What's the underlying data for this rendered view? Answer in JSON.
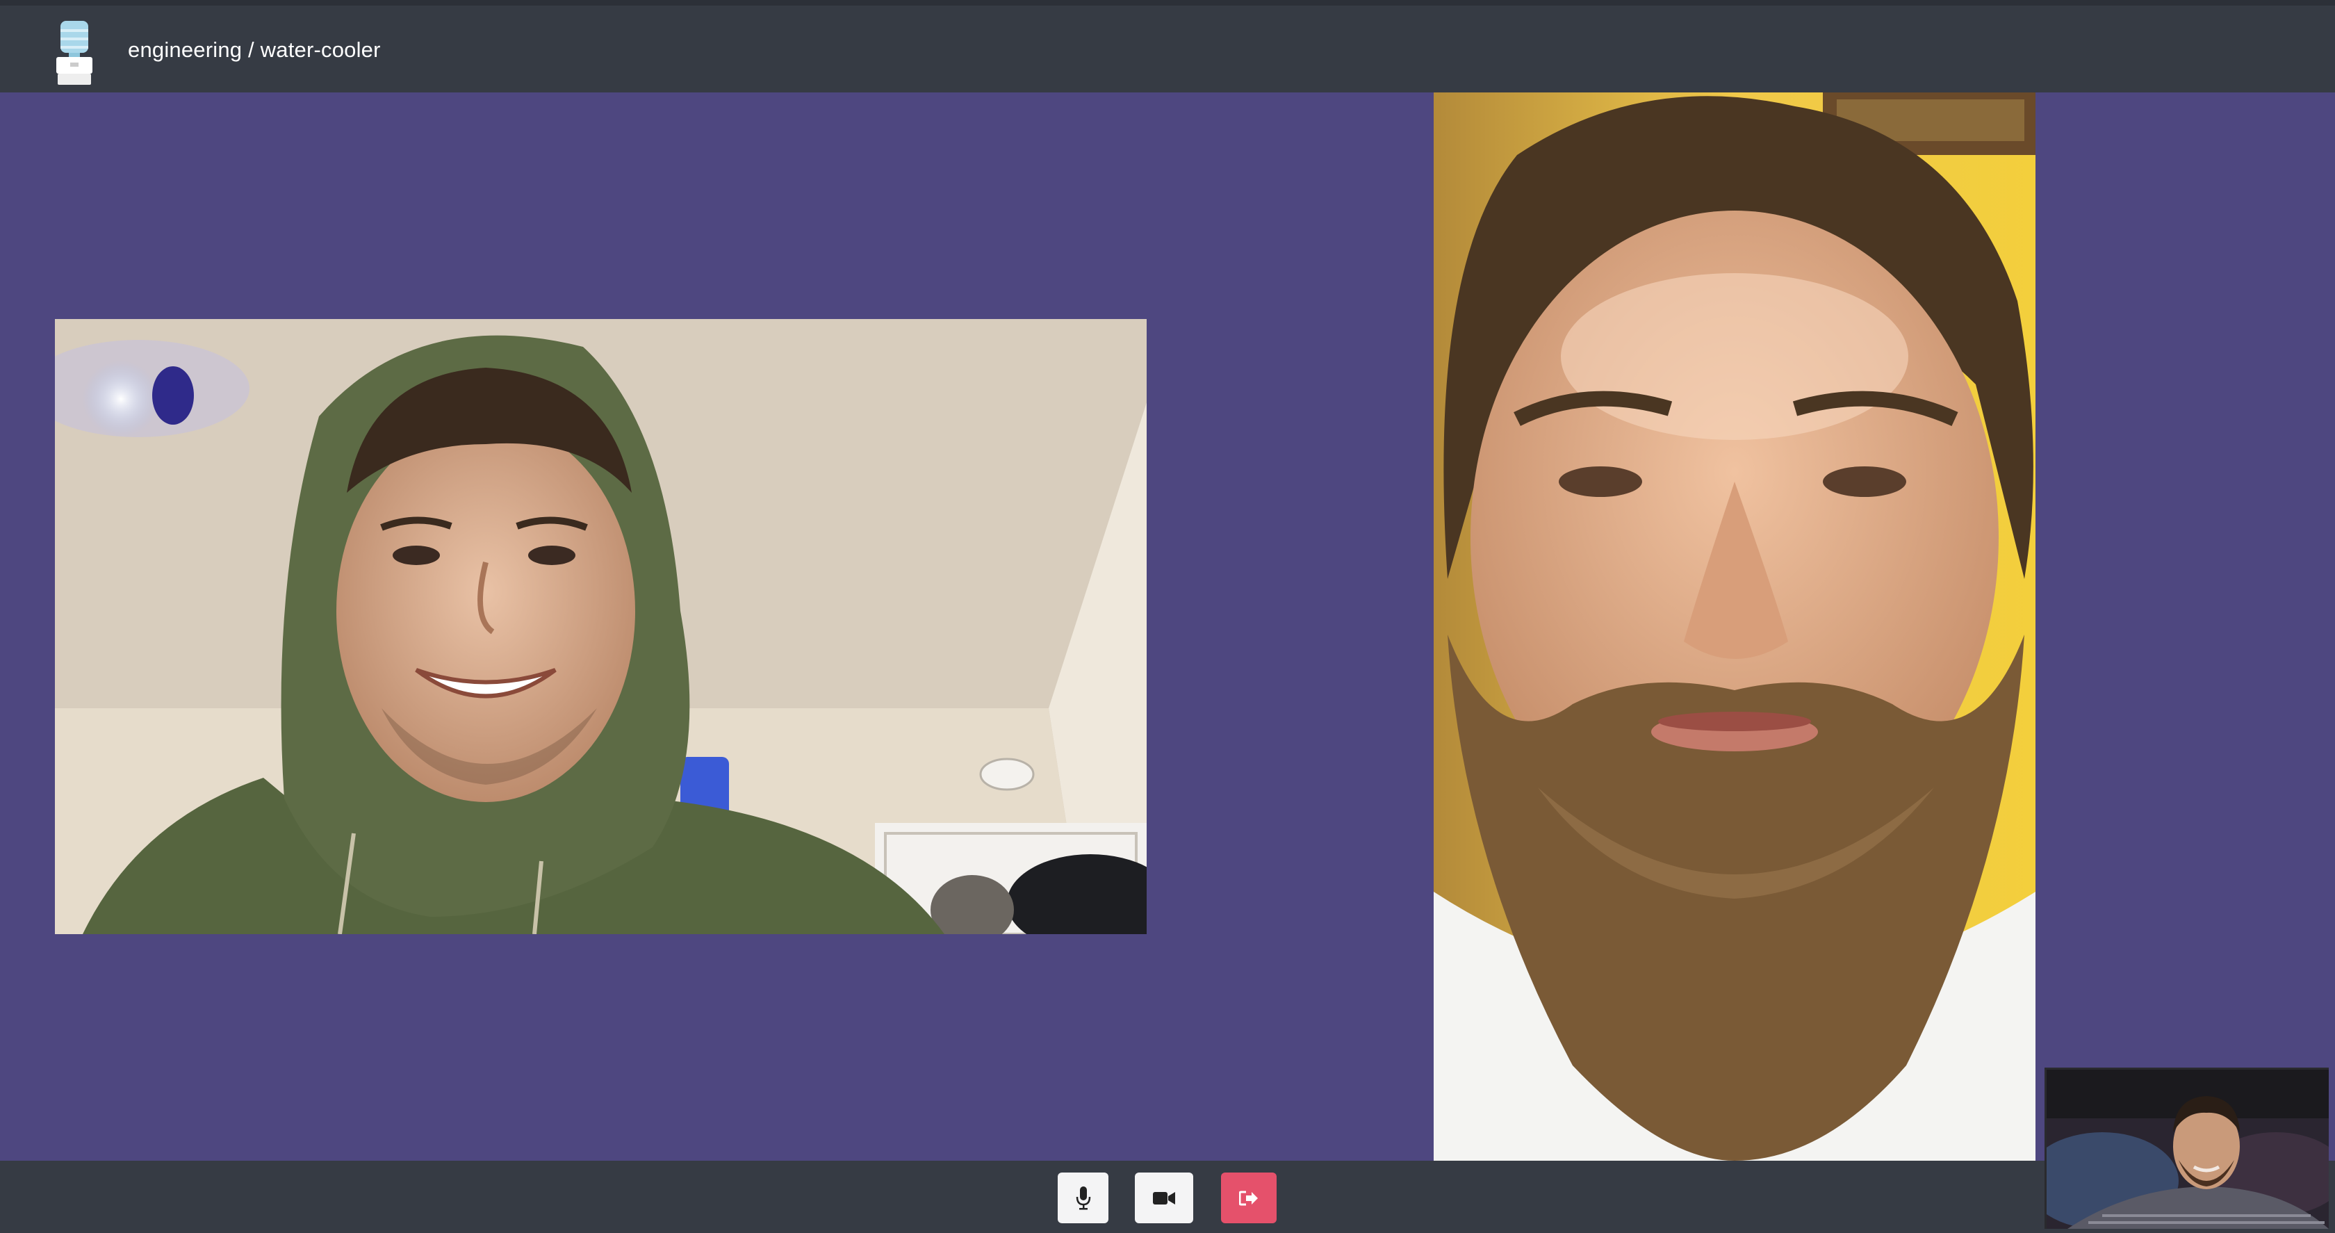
{
  "room": {
    "title": "engineering / water-cooler",
    "logo_icon": "water-cooler-icon"
  },
  "participants": [
    {
      "tile": "remote-video-left"
    },
    {
      "tile": "remote-video-right"
    }
  ],
  "self_view": {
    "tile": "local-self-view"
  },
  "controls": {
    "mic_icon": "microphone-icon",
    "camera_icon": "video-camera-icon",
    "leave_icon": "sign-out-icon",
    "leave_color": "#e5516b"
  },
  "colors": {
    "topbar": "#363b44",
    "stage": "#4e4780",
    "bottombar": "#363b44"
  }
}
